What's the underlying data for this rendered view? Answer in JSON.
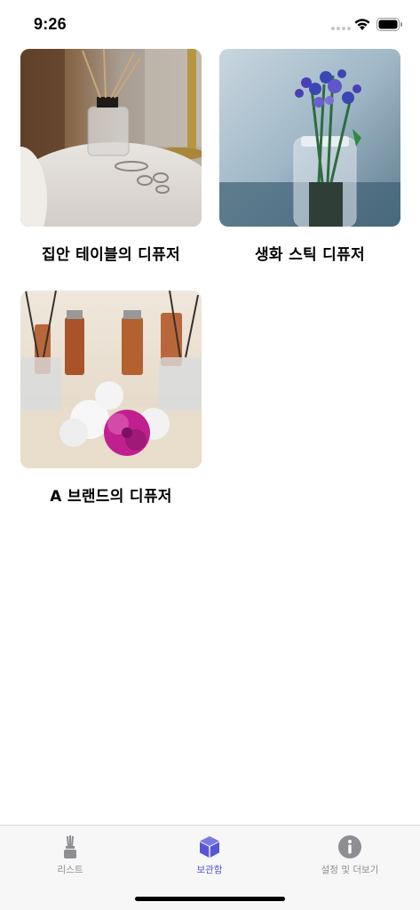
{
  "status_bar": {
    "time": "9:26"
  },
  "items": [
    {
      "title": "집안 테이블의 디퓨저",
      "image": "diffuser on marble table photo"
    },
    {
      "title": "생화 스틱 디퓨저",
      "image": "flower stick diffuser jar photo"
    },
    {
      "title": "A 브랜드의 디퓨저",
      "image": "brand diffuser bottles with flowers photo"
    }
  ],
  "tab_bar": {
    "tabs": [
      {
        "label": "리스트",
        "icon": "diffuser-icon",
        "active": false
      },
      {
        "label": "보관함",
        "icon": "box-icon",
        "active": true
      },
      {
        "label": "설정 및 더보기",
        "icon": "info-icon",
        "active": false
      }
    ],
    "colors": {
      "active": "#5856d6",
      "inactive": "#8e8e93"
    }
  }
}
